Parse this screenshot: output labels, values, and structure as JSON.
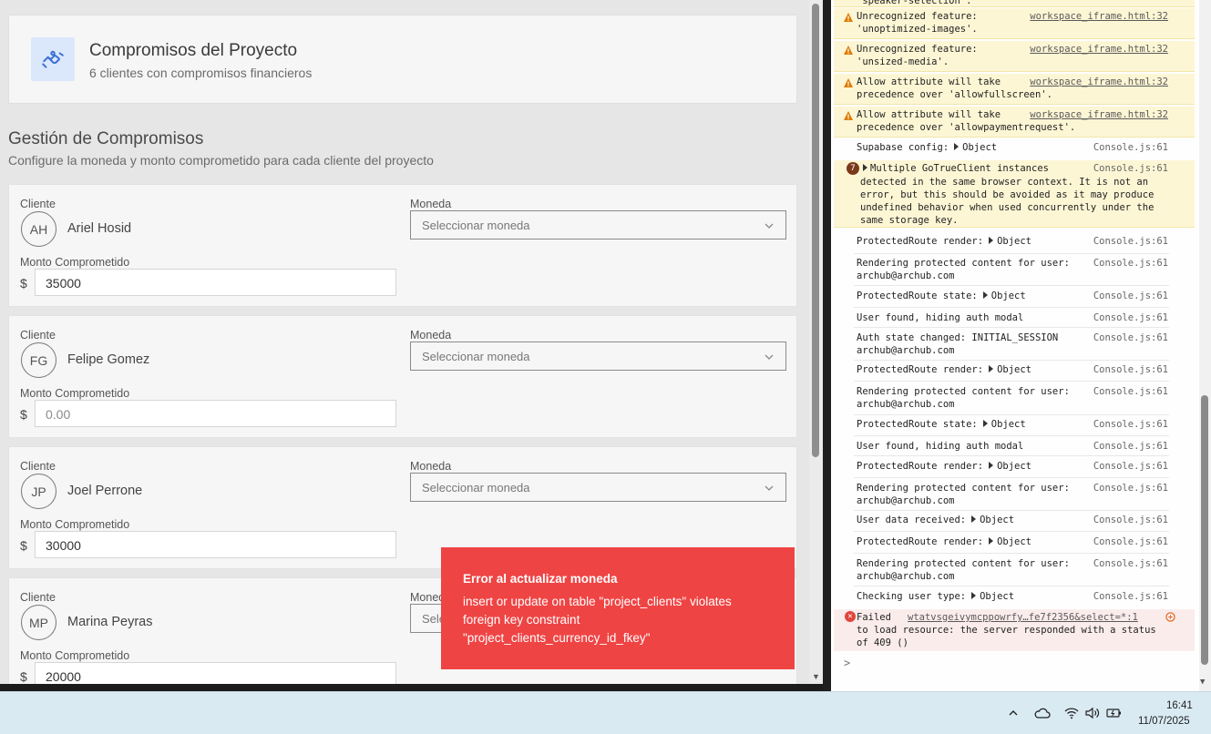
{
  "header": {
    "title": "Compromisos del Proyecto",
    "subtitle": "6 clientes con compromisos financieros"
  },
  "section": {
    "title": "Gestión de Compromisos",
    "subtitle": "Configure la moneda y monto comprometido para cada cliente del proyecto"
  },
  "labels": {
    "client": "Cliente",
    "currency": "Moneda",
    "amount": "Monto Comprometido",
    "dollar": "$"
  },
  "clients": [
    {
      "initials": "AH",
      "name": "Ariel Hosid",
      "currency_placeholder": "Seleccionar moneda",
      "amount": "35000"
    },
    {
      "initials": "FG",
      "name": "Felipe Gomez",
      "currency_placeholder": "Seleccionar moneda",
      "amount_placeholder": "0.00"
    },
    {
      "initials": "JP",
      "name": "Joel Perrone",
      "currency_placeholder": "Seleccionar moneda",
      "amount": "30000"
    },
    {
      "initials": "MP",
      "name": "Marina Peyras",
      "currency_placeholder": "Sele",
      "amount": "20000"
    }
  ],
  "toast": {
    "title": "Error al actualizar moneda",
    "line1": "insert or update on table \"project_clients\" violates",
    "line2": "foreign key constraint",
    "line3": "\"project_clients_currency_id_fkey\"",
    "color": "#ef4444"
  },
  "console": {
    "top_clip": "'speaker-selection'.",
    "entries": [
      {
        "msg1": "Unrecognized feature:",
        "msg2": "'unoptimized-images'.",
        "src": "workspace_iframe.html:32"
      },
      {
        "msg1": "Unrecognized feature:",
        "msg2": "'unsized-media'.",
        "src": "workspace_iframe.html:32"
      },
      {
        "msg1": "Allow attribute will take",
        "msg2": "precedence over 'allowfullscreen'.",
        "src": "workspace_iframe.html:32"
      },
      {
        "msg1": "Allow attribute will take",
        "msg2": "precedence over 'allowpaymentrequest'.",
        "src": "workspace_iframe.html:32"
      }
    ],
    "supabase": {
      "msg": "Supabase config:",
      "obj": "Object",
      "src": "Console.js:61"
    },
    "gotrue": {
      "count": "7",
      "l1": "Multiple GoTrueClient instances",
      "l2": "detected in the same browser context. It is not an",
      "l3": "error, but this should be avoided as it may produce",
      "l4": "undefined behavior when used concurrently under the",
      "l5": "same storage key.",
      "src": "Console.js:61"
    },
    "logs": [
      {
        "l1": "ProtectedRoute render:",
        "obj": "Object",
        "src": "Console.js:61"
      },
      {
        "l1": "Rendering protected content for user:",
        "l2": "archub@archub.com",
        "src": "Console.js:61"
      },
      {
        "l1": "ProtectedRoute state:",
        "obj": "Object",
        "src": "Console.js:61"
      },
      {
        "l1": "User found, hiding auth modal",
        "src": "Console.js:61"
      },
      {
        "l1": "Auth state changed: INITIAL_SESSION",
        "l2": "archub@archub.com",
        "src": "Console.js:61"
      },
      {
        "l1": "ProtectedRoute render:",
        "obj": "Object",
        "src": "Console.js:61"
      },
      {
        "l1": "Rendering protected content for user:",
        "l2": "archub@archub.com",
        "src": "Console.js:61"
      },
      {
        "l1": "ProtectedRoute state:",
        "obj": "Object",
        "src": "Console.js:61"
      },
      {
        "l1": "User found, hiding auth modal",
        "src": "Console.js:61"
      },
      {
        "l1": "ProtectedRoute render:",
        "obj": "Object",
        "src": "Console.js:61"
      },
      {
        "l1": "Rendering protected content for user:",
        "l2": "archub@archub.com",
        "src": "Console.js:61"
      },
      {
        "l1": "User data received:",
        "obj": "Object",
        "src": "Console.js:61"
      },
      {
        "l1": "ProtectedRoute render:",
        "obj": "Object",
        "src": "Console.js:61"
      },
      {
        "l1": "Rendering protected content for user:",
        "l2": "archub@archub.com",
        "src": "Console.js:61"
      },
      {
        "l1": "Checking user type:",
        "obj": "Object",
        "src": "Console.js:61"
      }
    ],
    "error": {
      "word": "Failed",
      "url": "wtatvsgeivymcppowrfy…fe7f2356&select=*:1",
      "l2": "to load resource: the server responded with a status",
      "l3": "of 409 ()"
    },
    "prompt": ">"
  },
  "taskbar": {
    "time": "16:41",
    "date": "11/07/2025"
  }
}
